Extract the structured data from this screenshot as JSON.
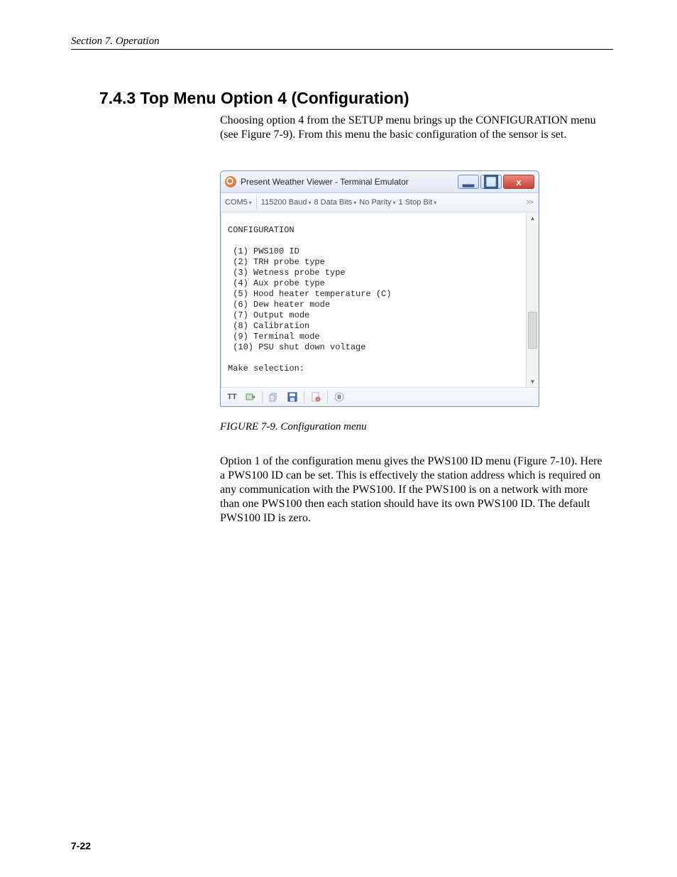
{
  "header": {
    "running": "Section 7.  Operation"
  },
  "heading": "7.4.3  Top Menu Option 4 (Configuration)",
  "paragraph1": "Choosing option 4 from the SETUP menu brings up the CONFIGURATION menu (see Figure 7-9). From this menu the basic configuration of the sensor is set.",
  "window": {
    "title": "Present Weather Viewer - Terminal Emulator",
    "min_label": "—",
    "max_label": "▣",
    "close_label": "x"
  },
  "toolbar": {
    "port": "COM5",
    "baud": "115200 Baud",
    "databits": "8 Data Bits",
    "parity": "No Parity",
    "stopbit": "1 Stop Bit",
    "overflow": ">>"
  },
  "terminal": {
    "header": "CONFIGURATION",
    "items": [
      " (1) PWS100 ID",
      " (2) TRH probe type",
      " (3) Wetness probe type",
      " (4) Aux probe type",
      " (5) Hood heater temperature (C)",
      " (6) Dew heater mode",
      " (7) Output mode",
      " (8) Calibration",
      " (9) Terminal mode",
      " (10) PSU shut down voltage"
    ],
    "prompt": "Make selection:"
  },
  "statusbar": {
    "tt": "TT"
  },
  "caption": "FIGURE 7-9.  Configuration menu",
  "paragraph2": "Option 1 of the configuration menu gives the PWS100 ID menu (Figure 7-10). Here a PWS100 ID can be set. This is effectively the station address which is required on any communication with the PWS100. If the PWS100 is on a network with more than one PWS100 then each station should have its own PWS100 ID. The default PWS100 ID is zero.",
  "page_number": "7-22"
}
